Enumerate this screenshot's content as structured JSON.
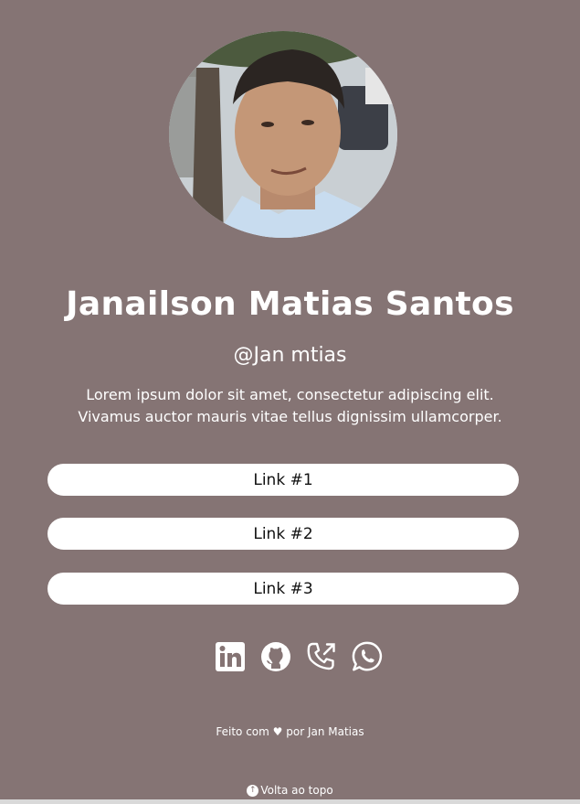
{
  "profile": {
    "name": "Janailson Matias Santos",
    "handle": "@Jan mtias",
    "bio_line1": "Lorem ipsum dolor sit amet, consectetur adipiscing elit.",
    "bio_line2": "Vivamus auctor mauris vitae tellus dignissim ullamcorper."
  },
  "links": {
    "link1": "Link #1",
    "link2": "Link #2",
    "link3": "Link #3"
  },
  "socials": {
    "icons": [
      "linkedin-icon",
      "github-icon",
      "phone-outgoing-icon",
      "whatsapp-icon"
    ]
  },
  "footer": {
    "made_with": "Feito com",
    "by": "por Jan Matias",
    "heart_symbol": "♥"
  },
  "back_to_top": {
    "label": "Volta ao topo",
    "arrow": "↑"
  },
  "colors": {
    "background": "#857474",
    "button": "#ffffff",
    "text": "#ffffff"
  }
}
